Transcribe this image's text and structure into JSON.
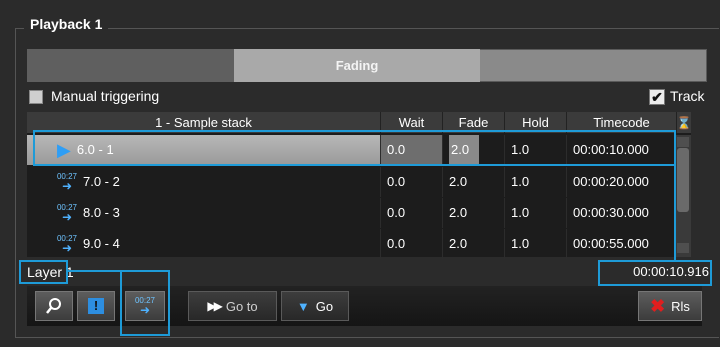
{
  "panel": {
    "title": "Playback 1"
  },
  "progress": {
    "label": "Fading"
  },
  "options": {
    "manual_triggering": "Manual triggering",
    "track_checked": true,
    "track_label": "Track"
  },
  "table": {
    "columns": [
      "1 - Sample stack",
      "Wait",
      "Fade",
      "Hold",
      "Timecode"
    ],
    "rows": [
      {
        "name": "6.0 - 1",
        "wait": "0.0",
        "fade": "2.0",
        "hold": "1.0",
        "timecode": "00:00:10.000",
        "selected": true
      },
      {
        "name": "7.0 - 2",
        "wait": "0.0",
        "fade": "2.0",
        "hold": "1.0",
        "timecode": "00:00:20.000"
      },
      {
        "name": "8.0 - 3",
        "wait": "0.0",
        "fade": "2.0",
        "hold": "1.0",
        "timecode": "00:00:30.000"
      },
      {
        "name": "9.0 - 4",
        "wait": "0.0",
        "fade": "2.0",
        "hold": "1.0",
        "timecode": "00:00:55.000"
      }
    ]
  },
  "status": {
    "layer": "Layer 1",
    "timecode": "00:00:10.916"
  },
  "toolbar": {
    "timecode_icon_text": "00:27",
    "goto_label": "Go to",
    "go_label": "Go",
    "release_label": "Rls"
  },
  "colors": {
    "highlight": "#1e9bd8",
    "accent_blue": "#4fb2ff",
    "release_red": "#e01e1e"
  }
}
